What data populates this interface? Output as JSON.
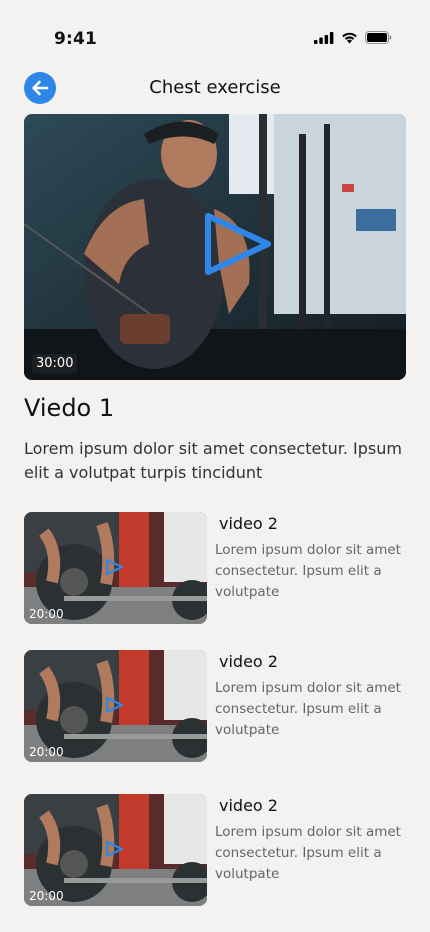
{
  "status_bar": {
    "time": "9:41"
  },
  "header": {
    "title": "Chest exercise"
  },
  "main_video": {
    "duration": "30:00",
    "title": "Viedo 1",
    "description": "Lorem ipsum dolor sit amet consectetur. Ipsum elit a volutpat turpis tincidunt"
  },
  "videos": [
    {
      "title": "video 2",
      "duration": "20:00",
      "description": "Lorem ipsum dolor sit amet consectetur. Ipsum elit a volutpate"
    },
    {
      "title": "video 2",
      "duration": "20:00",
      "description": "Lorem ipsum dolor sit amet consectetur. Ipsum elit a volutpate"
    },
    {
      "title": "video 2",
      "duration": "20:00",
      "description": "Lorem ipsum dolor sit amet consectetur. Ipsum elit a volutpate"
    }
  ],
  "colors": {
    "accent": "#2f86e6",
    "background": "#f3f2f0"
  }
}
